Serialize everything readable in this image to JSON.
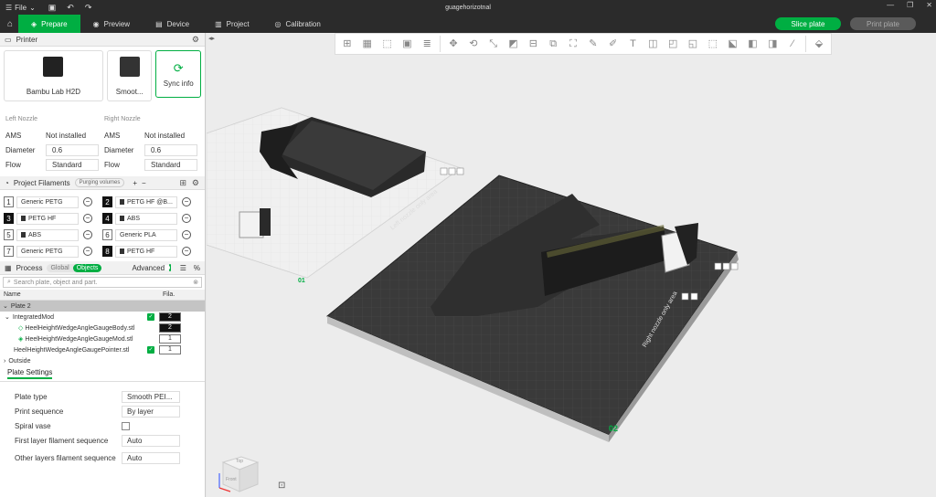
{
  "titlebar": {
    "file_label": "File",
    "title": "guagehorizotnal"
  },
  "tabs": [
    {
      "label": "Prepare",
      "icon": "prepare-icon"
    },
    {
      "label": "Preview",
      "icon": "preview-icon"
    },
    {
      "label": "Device",
      "icon": "device-icon"
    },
    {
      "label": "Project",
      "icon": "project-icon"
    },
    {
      "label": "Calibration",
      "icon": "calibration-icon"
    }
  ],
  "actions": {
    "slice": "Slice plate",
    "print": "Print plate"
  },
  "printer": {
    "section_title": "Printer",
    "model": "Bambu Lab H2D",
    "plate": "Smoot...",
    "sync_label": "Sync info"
  },
  "nozzles": {
    "left": {
      "title": "Left Nozzle",
      "ams_label": "AMS",
      "ams_value": "Not installed",
      "diameter_label": "Diameter",
      "diameter": "0.6",
      "flow_label": "Flow",
      "flow": "Standard"
    },
    "right": {
      "title": "Right Nozzle",
      "ams_label": "AMS",
      "ams_value": "Not installed",
      "diameter_label": "Diameter",
      "diameter": "0.6",
      "flow_label": "Flow",
      "flow": "Standard"
    }
  },
  "filaments": {
    "section_title": "Project Filaments",
    "purge_label": "Purging volumes",
    "items": [
      {
        "num": "1",
        "name": "Generic PETG"
      },
      {
        "num": "2",
        "name": "PETG HF @B..."
      },
      {
        "num": "3",
        "name": "PETG HF"
      },
      {
        "num": "4",
        "name": "ABS"
      },
      {
        "num": "5",
        "name": "ABS"
      },
      {
        "num": "6",
        "name": "Generic PLA"
      },
      {
        "num": "7",
        "name": "Generic PETG"
      },
      {
        "num": "8",
        "name": "PETG HF"
      }
    ]
  },
  "process": {
    "title": "Process",
    "global_label": "Global",
    "objects_label": "Objects",
    "advanced_label": "Advanced",
    "search_placeholder": "Search plate, object and part.",
    "col_name": "Name",
    "col_fila": "Fila.",
    "tree": [
      {
        "label": "Plate 2",
        "fila": ""
      },
      {
        "label": "IntegratedMod",
        "fila": "2"
      },
      {
        "label": "HeelHeightWedgeAngleGaugeBody.stl",
        "fila": "2"
      },
      {
        "label": "HeelHeightWedgeAngleGaugeMod.stl",
        "fila": "1"
      },
      {
        "label": "HeelHeightWedgeAngleGaugePointer.stl",
        "fila": "1"
      },
      {
        "label": "Outside",
        "fila": ""
      }
    ]
  },
  "plate_settings": {
    "tab": "Plate Settings",
    "plate_type_label": "Plate type",
    "plate_type": "Smooth PEI...",
    "print_seq_label": "Print sequence",
    "print_seq": "By layer",
    "spiral_label": "Spiral vase",
    "first_layer_label": "First layer filament sequence",
    "first_layer": "Auto",
    "other_layers_label": "Other layers filament sequence",
    "other_layers": "Auto"
  },
  "viewport": {
    "plate1_label": "01",
    "plate2_label": "02",
    "left_nozzle_area": "Left nozzle only area",
    "right_nozzle_area": "Right nozzle only area",
    "cube_labels": {
      "top": "Top",
      "front": "Front"
    }
  },
  "colors": {
    "accent": "#00ae42",
    "titlebar": "#2b2b2b"
  }
}
